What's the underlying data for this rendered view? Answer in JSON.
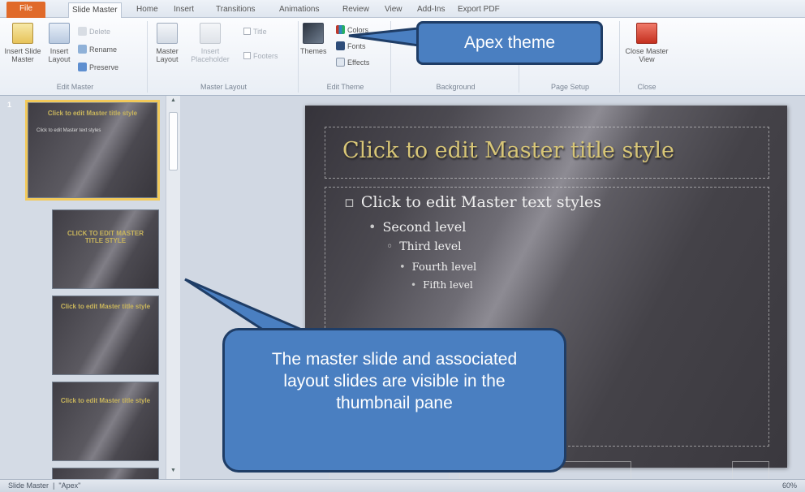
{
  "tabs": [
    {
      "label": "File"
    },
    {
      "label": "Slide Master"
    },
    {
      "label": "Home"
    },
    {
      "label": "Insert"
    },
    {
      "label": "Transitions"
    },
    {
      "label": "Animations"
    },
    {
      "label": "Review"
    },
    {
      "label": "View"
    },
    {
      "label": "Add-Ins"
    },
    {
      "label": "Export PDF"
    }
  ],
  "ribbon": {
    "edit_master": {
      "label": "Edit Master",
      "insert_slide_master": "Insert Slide Master",
      "insert_layout": "Insert Layout",
      "delete": "Delete",
      "rename": "Rename",
      "preserve": "Preserve"
    },
    "master_layout": {
      "label": "Master Layout",
      "master_layout_btn": "Master Layout",
      "insert_placeholder": "Insert Placeholder",
      "title": "Title",
      "footers": "Footers"
    },
    "edit_theme": {
      "label": "Edit Theme",
      "themes": "Themes",
      "colors": "Colors",
      "fonts": "Fonts",
      "effects": "Effects"
    },
    "background": {
      "label": "Background"
    },
    "page_setup": {
      "label": "Page Setup"
    },
    "close": {
      "label": "Close",
      "close_master_view": "Close Master View"
    }
  },
  "thumbnails": {
    "first_number": "1",
    "items": [
      {
        "title": "Click to edit Master title style",
        "body": "Click to edit Master text styles"
      },
      {
        "title": "CLICK TO EDIT MASTER TITLE STYLE",
        "body": ""
      },
      {
        "title": "Click to edit Master title style",
        "body": ""
      },
      {
        "title": "Click to edit Master title style",
        "body": ""
      },
      {
        "title": "",
        "body": ""
      }
    ]
  },
  "slide": {
    "title": "Click to edit Master title style",
    "levels": [
      "Click to edit Master text styles",
      "Second level",
      "Third level",
      "Fourth level",
      "Fifth level"
    ]
  },
  "statusbar": {
    "view": "Slide Master",
    "theme": "\"Apex\"",
    "zoom": "60%"
  },
  "callouts": {
    "top": "Apex theme",
    "bottom": "The master slide and associated layout slides are visible in the thumbnail pane"
  },
  "colors": {
    "file_tab": "#e06a2a",
    "callout_fill": "#4a7fc1",
    "callout_border": "#1f3d66",
    "slide_title": "#d8c677"
  }
}
